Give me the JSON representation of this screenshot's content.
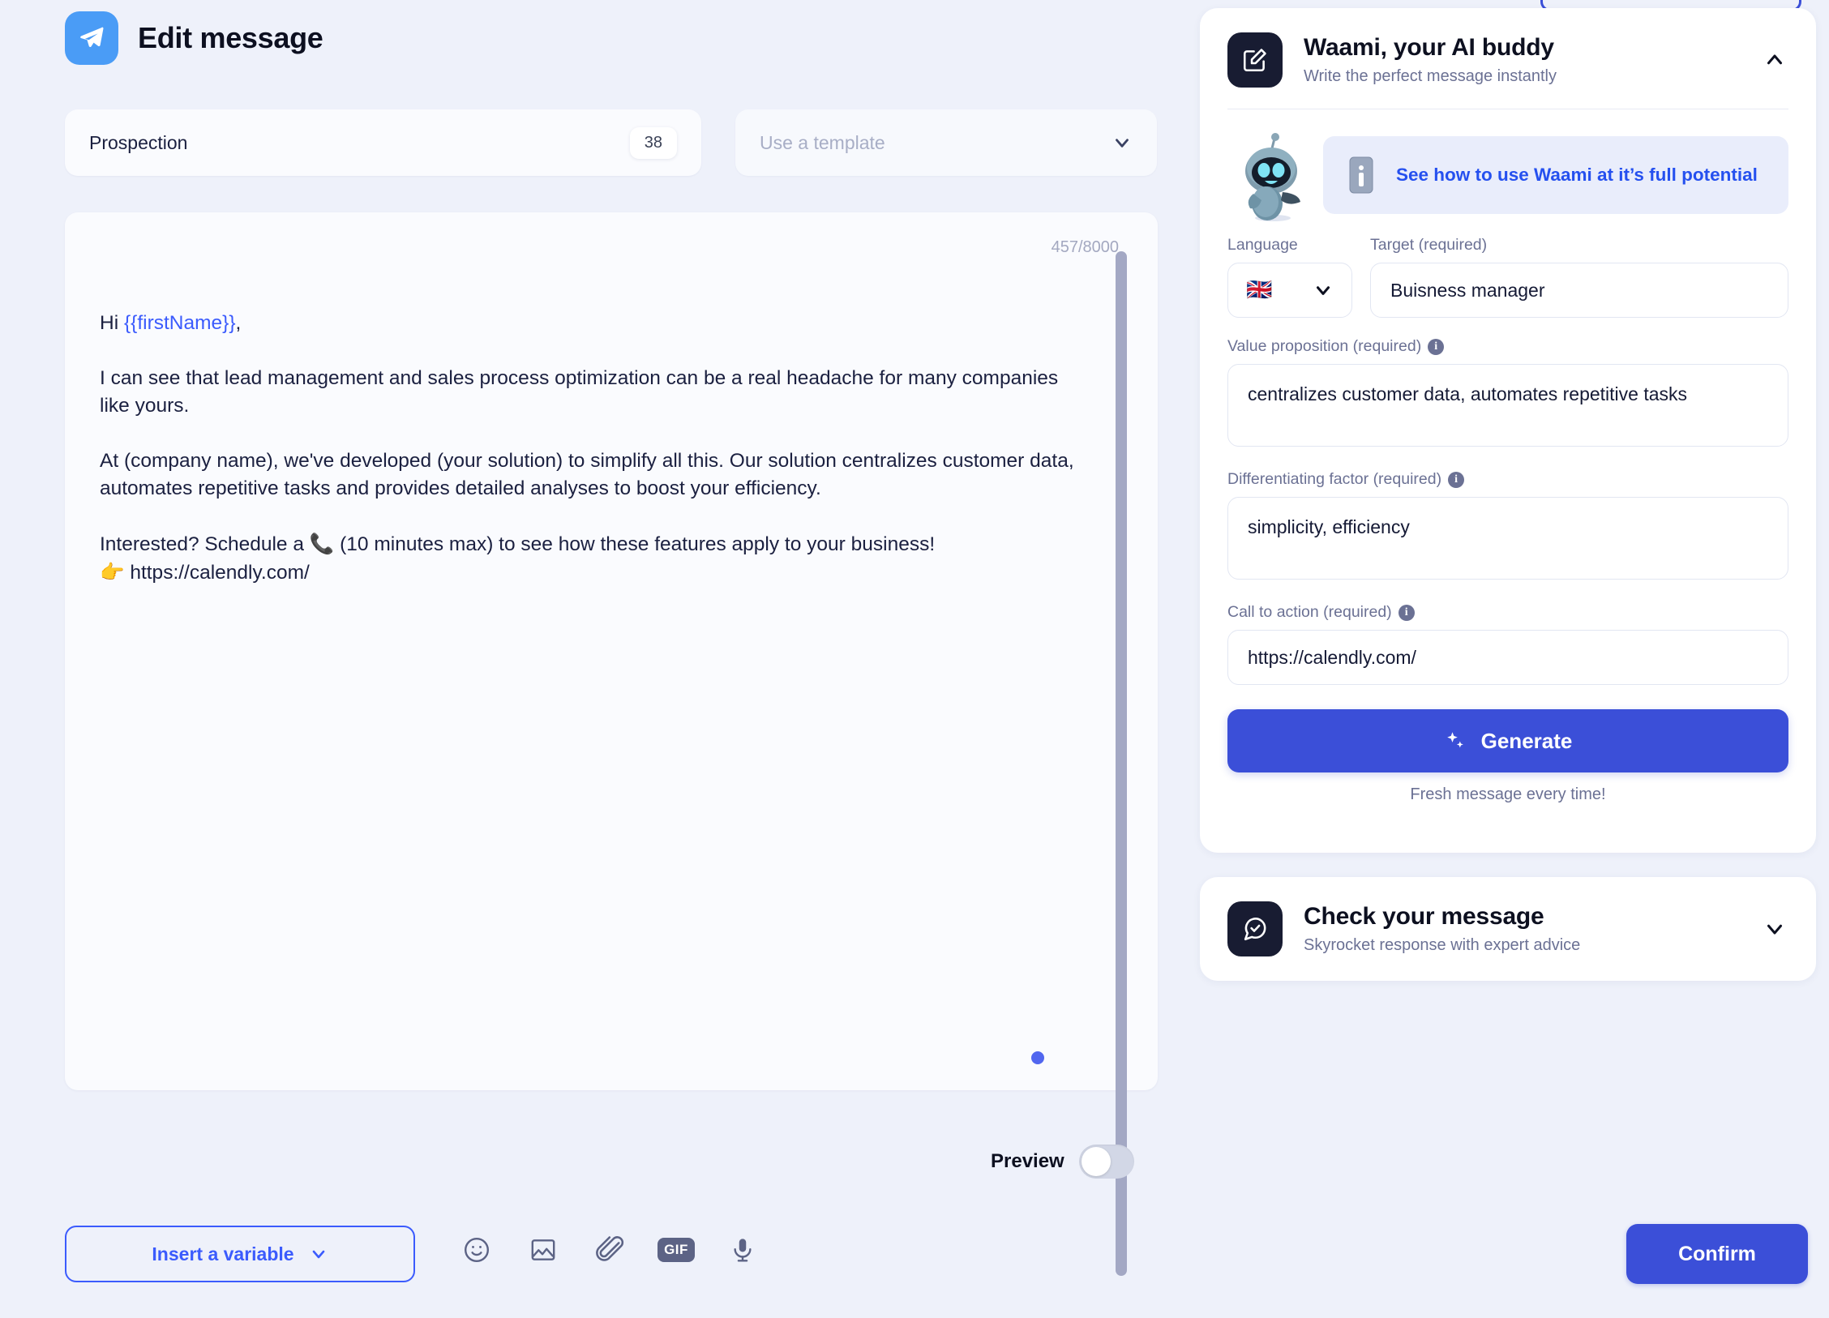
{
  "header": {
    "title": "Edit message",
    "icon": "send-paper-plane-icon"
  },
  "message_meta": {
    "name_value": "Prospection",
    "char_pill": "38",
    "template_placeholder": "Use a template",
    "template_chevron": "chevron-down-icon"
  },
  "editor": {
    "char_counter": "457/8000",
    "paragraphs": [
      {
        "prefix": "Hi ",
        "variable": "{{firstName}}",
        "suffix": ","
      },
      {
        "text": "I can see that lead management and sales process optimization can be a real headache for many companies like yours."
      },
      {
        "text": "At (company name), we've developed (your solution) to simplify all this. Our solution centralizes customer data, automates repetitive tasks and provides detailed analyses to boost your efficiency."
      },
      {
        "line1_a": "Interested? Schedule a ",
        "line1_emoji": "📞",
        "line1_b": " (10 minutes max) to see how these features apply to your business!",
        "line2_emoji": "👉",
        "line2_text": " https://calendly.com/"
      }
    ]
  },
  "preview": {
    "label": "Preview",
    "enabled": false
  },
  "bottom_bar": {
    "insert_variable_label": "Insert a variable",
    "insert_variable_chevron": "chevron-down-icon",
    "icons": [
      {
        "name": "emoji-smiley-icon",
        "label": "Emoji"
      },
      {
        "name": "image-icon",
        "label": "Image"
      },
      {
        "name": "paperclip-icon",
        "label": "Attachment"
      },
      {
        "name": "gif-icon",
        "label": "GIF"
      },
      {
        "name": "microphone-icon",
        "label": "Voice note"
      }
    ],
    "gif_text": "GIF",
    "confirm_label": "Confirm"
  },
  "waami_card": {
    "title": "Waami, your AI buddy",
    "subtitle": "Write the perfect message instantly",
    "icon": "edit-square-pencil-icon",
    "collapse_icon": "chevron-up-icon",
    "mascot": "robot-mascot-icon",
    "promo": {
      "icon": "info-icon",
      "text": "See how to use Waami at it’s full potential"
    },
    "fields": {
      "language_label": "Language",
      "language_flag": "🇬🇧",
      "language_chevron": "chevron-down-icon",
      "target_label": "Target (required)",
      "target_value": "Buisness manager",
      "value_prop_label": "Value proposition (required)",
      "value_prop_info": "i",
      "value_prop_value": "centralizes customer data, automates repetitive tasks",
      "diff_factor_label": "Differentiating factor (required)",
      "diff_factor_info": "i",
      "diff_factor_value": "simplicity, efficiency",
      "cta_label": "Call to action (required)",
      "cta_info": "i",
      "cta_value": "https://calendly.com/"
    },
    "generate_label": "Generate",
    "generate_icon": "sparkles-icon",
    "generate_sub": "Fresh message every time!"
  },
  "check_card": {
    "title": "Check your message",
    "subtitle": "Skyrocket response with expert advice",
    "icon": "chat-check-icon",
    "expand_icon": "chevron-down-icon"
  },
  "colors": {
    "page_bg": "#eef1fa",
    "accent_blue": "#3b4fd8",
    "link_blue": "#2550ef",
    "variable_blue": "#3b5bfd",
    "header_badge": "#4a9cf6",
    "dark_icon": "#181c32",
    "muted_text": "#6b7194"
  }
}
